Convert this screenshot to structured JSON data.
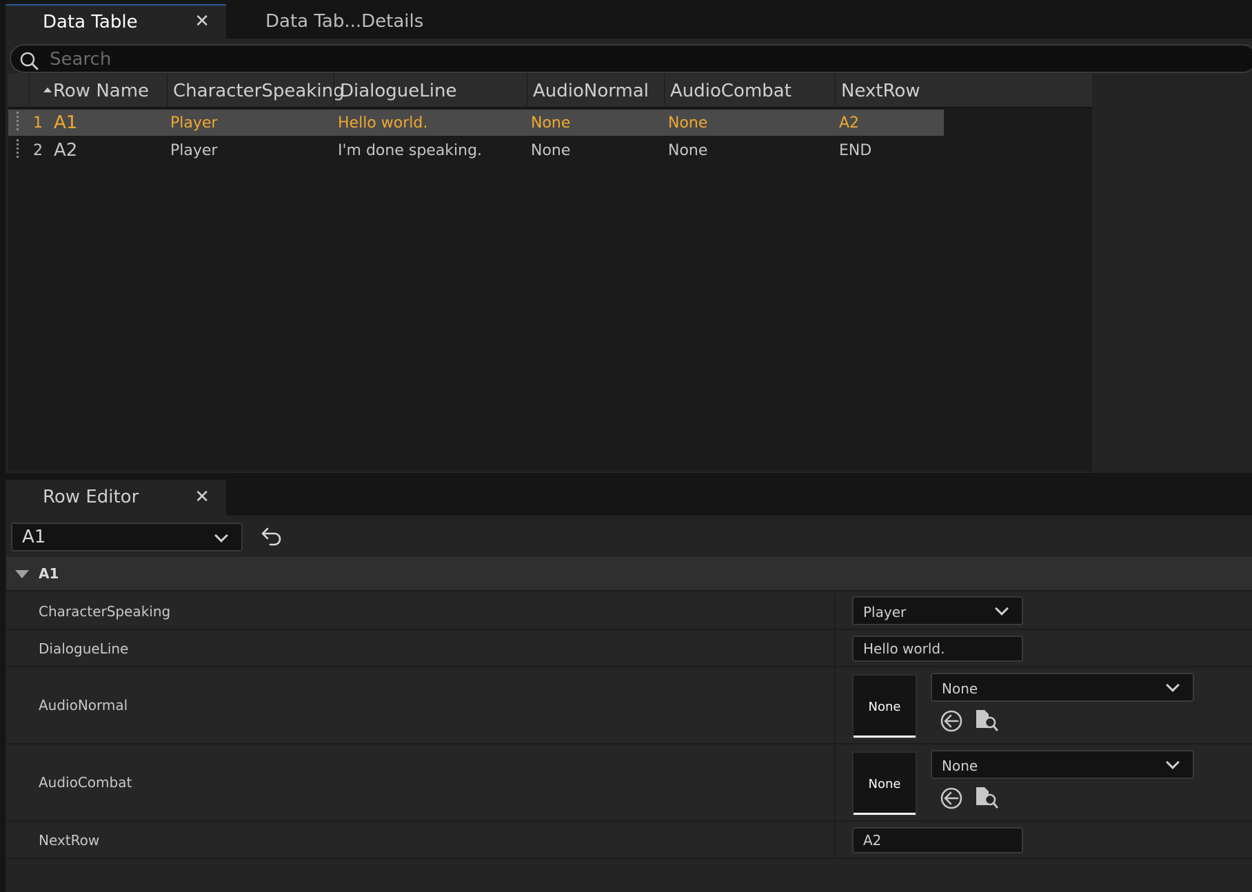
{
  "tabs": {
    "active": {
      "label": "Data Table"
    },
    "inactive": {
      "label": "Data Tab...Details"
    }
  },
  "search": {
    "placeholder": "Search",
    "value": ""
  },
  "table": {
    "columns": [
      "Row Name",
      "CharacterSpeaking",
      "DialogueLine",
      "AudioNormal",
      "AudioCombat",
      "NextRow"
    ],
    "rows": [
      {
        "index": "1",
        "name": "A1",
        "character": "Player",
        "dialogue": "Hello world.",
        "audio_normal": "None",
        "audio_combat": "None",
        "next": "A2"
      },
      {
        "index": "2",
        "name": "A2",
        "character": "Player",
        "dialogue": "I'm done speaking.",
        "audio_normal": "None",
        "audio_combat": "None",
        "next": "END"
      }
    ]
  },
  "editor": {
    "tab_label": "Row Editor",
    "selected_row": "A1",
    "section_title": "A1",
    "props": {
      "character_label": "CharacterSpeaking",
      "character_value": "Player",
      "dialogue_label": "DialogueLine",
      "dialogue_value": "Hello world.",
      "audio_normal_label": "AudioNormal",
      "audio_normal_thumb": "None",
      "audio_normal_value": "None",
      "audio_combat_label": "AudioCombat",
      "audio_combat_thumb": "None",
      "audio_combat_value": "None",
      "next_label": "NextRow",
      "next_value": "A2"
    }
  },
  "colors": {
    "selected_text": "#f0a830",
    "accent_tab": "#2a5a9c"
  }
}
